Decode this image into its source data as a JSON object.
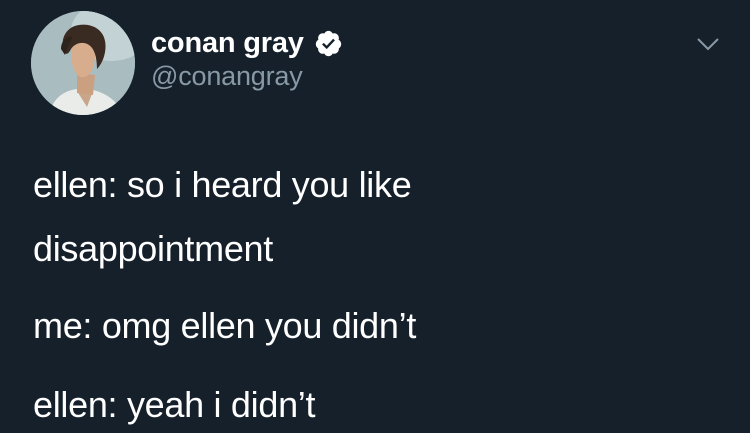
{
  "tweet": {
    "author": {
      "display_name": "conan gray",
      "handle": "@conangray",
      "verified": true,
      "avatar_icon": "profile-photo"
    },
    "menu_icon": "chevron-down-icon",
    "text_lines": [
      "ellen: so i heard you like",
      "disappointment",
      "me: omg ellen you didn’t",
      "ellen: yeah i didn’t"
    ]
  },
  "colors": {
    "background": "#15202b",
    "text_primary": "#ffffff",
    "text_secondary": "#8899a6",
    "verified_badge": "#ffffff"
  }
}
